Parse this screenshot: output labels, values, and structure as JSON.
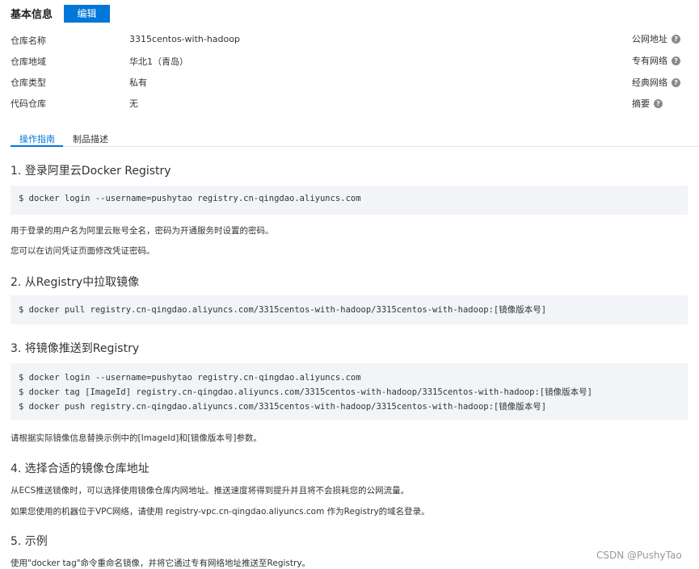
{
  "header": {
    "title": "基本信息",
    "edit_label": "编辑"
  },
  "info": {
    "rows": [
      {
        "label": "仓库名称",
        "value": "3315centos-with-hadoop"
      },
      {
        "label": "仓库地域",
        "value": "华北1（青岛）"
      },
      {
        "label": "仓库类型",
        "value": "私有"
      },
      {
        "label": "代码仓库",
        "value": "无"
      }
    ],
    "links": [
      "公网地址",
      "专有网络",
      "经典网络",
      "摘要"
    ]
  },
  "tabs": [
    {
      "label": "操作指南",
      "active": true
    },
    {
      "label": "制品描述",
      "active": false
    }
  ],
  "guide": {
    "s1": {
      "title": "1. 登录阿里云Docker Registry",
      "code": [
        "$ docker login --username=pushytao registry.cn-qingdao.aliyuncs.com"
      ],
      "notes": [
        "用于登录的用户名为阿里云账号全名，密码为开通服务时设置的密码。",
        "您可以在访问凭证页面修改凭证密码。"
      ]
    },
    "s2": {
      "title": "2. 从Registry中拉取镜像",
      "code": [
        "$ docker pull registry.cn-qingdao.aliyuncs.com/3315centos-with-hadoop/3315centos-with-hadoop:[镜像版本号]"
      ]
    },
    "s3": {
      "title": "3. 将镜像推送到Registry",
      "code": [
        "$ docker login --username=pushytao registry.cn-qingdao.aliyuncs.com",
        "$ docker tag [ImageId] registry.cn-qingdao.aliyuncs.com/3315centos-with-hadoop/3315centos-with-hadoop:[镜像版本号]",
        "$ docker push registry.cn-qingdao.aliyuncs.com/3315centos-with-hadoop/3315centos-with-hadoop:[镜像版本号]"
      ],
      "note": "请根据实际镜像信息替换示例中的[ImageId]和[镜像版本号]参数。"
    },
    "s4": {
      "title": "4. 选择合适的镜像仓库地址",
      "notes": [
        "从ECS推送镜像时，可以选择使用镜像仓库内网地址。推送速度将得到提升并且将不会损耗您的公网流量。",
        "如果您使用的机器位于VPC网络，请使用 registry-vpc.cn-qingdao.aliyuncs.com 作为Registry的域名登录。"
      ]
    },
    "s5": {
      "title": "5. 示例",
      "note": "使用\"docker tag\"命令重命名镜像，并将它通过专有网络地址推送至Registry。"
    }
  },
  "watermark": "CSDN @PushyTao",
  "colors": {
    "accent": "#0077d9",
    "code_bg": "#f2f4f7",
    "help_icon": "#8a8a8a"
  }
}
